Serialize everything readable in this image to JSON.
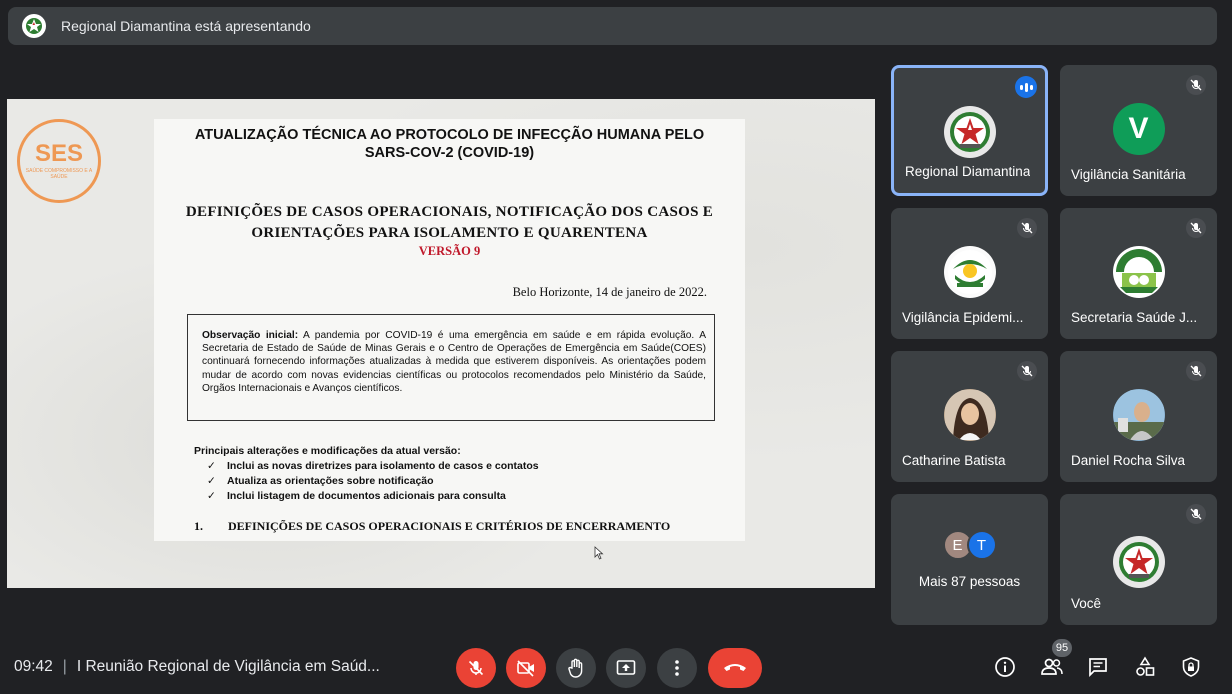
{
  "banner": {
    "presenting_text": "Regional Diamantina está apresentando",
    "icon": "shield-logo-icon"
  },
  "document": {
    "stamp_big": "SES",
    "stamp_small": "SAÚDE COMPROMISSO E A SAÚDE",
    "title": "ATUALIZAÇÃO TÉCNICA AO PROTOCOLO DE INFECÇÃO HUMANA PELO SARS-COV-2 (COVID-19)",
    "subtitle": "DEFINIÇÕES DE CASOS OPERACIONAIS, NOTIFICAÇÃO DOS CASOS E ORIENTAÇÕES PARA ISOLAMENTO E QUARENTENA",
    "version": "VERSÃO 9",
    "place_date": "Belo Horizonte, 14 de janeiro de 2022.",
    "obs_label": "Observação inicial:",
    "obs_text": " A pandemia por COVID-19 é uma emergência em saúde e em rápida evolução. A Secretaria de Estado de Saúde de Minas Gerais e o Centro de Operações de Emergência em Saúde(COES) continuará fornecendo informações atualizadas à medida que estiverem disponíveis. As orientações podem mudar de acordo com novas evidencias científicas ou protocolos recomendados pelo Ministério da Saúde, Orgãos Internacionais e Avanços científicos.",
    "changes_title": "Principais alterações e modificações da atual versão:",
    "changes": [
      "Inclui as novas diretrizes para isolamento de casos e contatos",
      "Atualiza as orientações sobre notificação",
      "Inclui listagem de documentos adicionais para consulta"
    ],
    "section_num": "1.",
    "section_title": "DEFINIÇÕES DE CASOS OPERACIONAIS E CRITÉRIOS DE ENCERRAMENTO"
  },
  "participants": [
    {
      "name": "Regional Diamantina",
      "speaking": true
    },
    {
      "name": "Vigilância Sanitária",
      "avatar_letter": "V",
      "avatar_color": "#0f9d58",
      "muted": true
    },
    {
      "name": "Vigilância Epidemi...",
      "muted": true
    },
    {
      "name": "Secretaria Saúde J...",
      "muted": true
    },
    {
      "name": "Catharine Batista",
      "muted": true
    },
    {
      "name": "Daniel Rocha Silva",
      "muted": true
    },
    {
      "name": "Mais 87 pessoas",
      "letters": [
        "E",
        "T"
      ],
      "colors": [
        "#a1887f",
        "#1a73e8"
      ]
    },
    {
      "name": "Você",
      "muted": true
    }
  ],
  "bottom": {
    "time": "09:42",
    "separator": "|",
    "meeting_title": "I Reunião Regional de Vigilância em Saúd...",
    "people_count": "95"
  },
  "colors": {
    "accent": "#8ab4f8",
    "danger": "#ea4335",
    "tile": "#3c4043",
    "background": "#202124"
  }
}
